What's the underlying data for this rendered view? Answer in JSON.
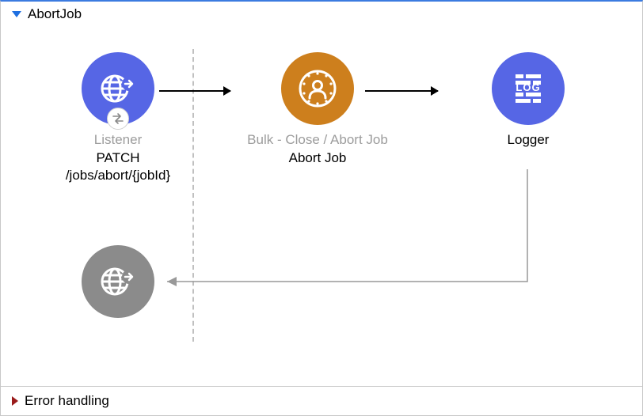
{
  "section": {
    "title": "AbortJob",
    "error_title": "Error handling"
  },
  "nodes": {
    "listener": {
      "sub": "Listener",
      "label": "PATCH /jobs/abort/{jobId}",
      "icon": "http-listener-icon",
      "color": "#5666e5"
    },
    "abort": {
      "sub": "Bulk - Close / Abort Job",
      "label": "Abort Job",
      "icon": "bulk-icon",
      "color": "#cd7f1d"
    },
    "logger": {
      "sub": "",
      "label": "Logger",
      "icon": "logger-icon",
      "color": "#5666e5"
    },
    "response": {
      "icon": "http-response-icon",
      "color": "#8b8b8b"
    }
  }
}
